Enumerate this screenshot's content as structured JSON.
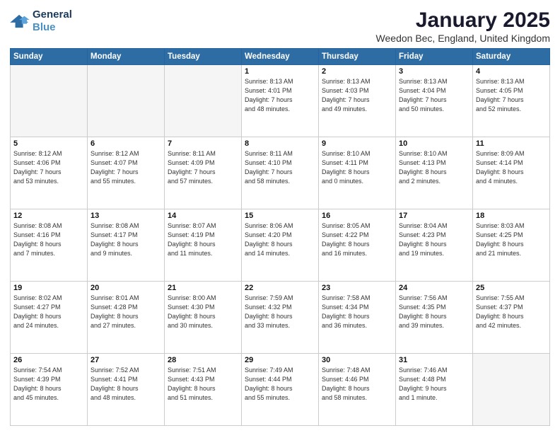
{
  "logo": {
    "line1": "General",
    "line2": "Blue"
  },
  "header": {
    "title": "January 2025",
    "location": "Weedon Bec, England, United Kingdom"
  },
  "weekdays": [
    "Sunday",
    "Monday",
    "Tuesday",
    "Wednesday",
    "Thursday",
    "Friday",
    "Saturday"
  ],
  "weeks": [
    [
      {
        "day": "",
        "text": "",
        "empty": true
      },
      {
        "day": "",
        "text": "",
        "empty": true
      },
      {
        "day": "",
        "text": "",
        "empty": true
      },
      {
        "day": "1",
        "text": "Sunrise: 8:13 AM\nSunset: 4:01 PM\nDaylight: 7 hours\nand 48 minutes."
      },
      {
        "day": "2",
        "text": "Sunrise: 8:13 AM\nSunset: 4:03 PM\nDaylight: 7 hours\nand 49 minutes."
      },
      {
        "day": "3",
        "text": "Sunrise: 8:13 AM\nSunset: 4:04 PM\nDaylight: 7 hours\nand 50 minutes."
      },
      {
        "day": "4",
        "text": "Sunrise: 8:13 AM\nSunset: 4:05 PM\nDaylight: 7 hours\nand 52 minutes."
      }
    ],
    [
      {
        "day": "5",
        "text": "Sunrise: 8:12 AM\nSunset: 4:06 PM\nDaylight: 7 hours\nand 53 minutes."
      },
      {
        "day": "6",
        "text": "Sunrise: 8:12 AM\nSunset: 4:07 PM\nDaylight: 7 hours\nand 55 minutes."
      },
      {
        "day": "7",
        "text": "Sunrise: 8:11 AM\nSunset: 4:09 PM\nDaylight: 7 hours\nand 57 minutes."
      },
      {
        "day": "8",
        "text": "Sunrise: 8:11 AM\nSunset: 4:10 PM\nDaylight: 7 hours\nand 58 minutes."
      },
      {
        "day": "9",
        "text": "Sunrise: 8:10 AM\nSunset: 4:11 PM\nDaylight: 8 hours\nand 0 minutes."
      },
      {
        "day": "10",
        "text": "Sunrise: 8:10 AM\nSunset: 4:13 PM\nDaylight: 8 hours\nand 2 minutes."
      },
      {
        "day": "11",
        "text": "Sunrise: 8:09 AM\nSunset: 4:14 PM\nDaylight: 8 hours\nand 4 minutes."
      }
    ],
    [
      {
        "day": "12",
        "text": "Sunrise: 8:08 AM\nSunset: 4:16 PM\nDaylight: 8 hours\nand 7 minutes."
      },
      {
        "day": "13",
        "text": "Sunrise: 8:08 AM\nSunset: 4:17 PM\nDaylight: 8 hours\nand 9 minutes."
      },
      {
        "day": "14",
        "text": "Sunrise: 8:07 AM\nSunset: 4:19 PM\nDaylight: 8 hours\nand 11 minutes."
      },
      {
        "day": "15",
        "text": "Sunrise: 8:06 AM\nSunset: 4:20 PM\nDaylight: 8 hours\nand 14 minutes."
      },
      {
        "day": "16",
        "text": "Sunrise: 8:05 AM\nSunset: 4:22 PM\nDaylight: 8 hours\nand 16 minutes."
      },
      {
        "day": "17",
        "text": "Sunrise: 8:04 AM\nSunset: 4:23 PM\nDaylight: 8 hours\nand 19 minutes."
      },
      {
        "day": "18",
        "text": "Sunrise: 8:03 AM\nSunset: 4:25 PM\nDaylight: 8 hours\nand 21 minutes."
      }
    ],
    [
      {
        "day": "19",
        "text": "Sunrise: 8:02 AM\nSunset: 4:27 PM\nDaylight: 8 hours\nand 24 minutes."
      },
      {
        "day": "20",
        "text": "Sunrise: 8:01 AM\nSunset: 4:28 PM\nDaylight: 8 hours\nand 27 minutes."
      },
      {
        "day": "21",
        "text": "Sunrise: 8:00 AM\nSunset: 4:30 PM\nDaylight: 8 hours\nand 30 minutes."
      },
      {
        "day": "22",
        "text": "Sunrise: 7:59 AM\nSunset: 4:32 PM\nDaylight: 8 hours\nand 33 minutes."
      },
      {
        "day": "23",
        "text": "Sunrise: 7:58 AM\nSunset: 4:34 PM\nDaylight: 8 hours\nand 36 minutes."
      },
      {
        "day": "24",
        "text": "Sunrise: 7:56 AM\nSunset: 4:35 PM\nDaylight: 8 hours\nand 39 minutes."
      },
      {
        "day": "25",
        "text": "Sunrise: 7:55 AM\nSunset: 4:37 PM\nDaylight: 8 hours\nand 42 minutes."
      }
    ],
    [
      {
        "day": "26",
        "text": "Sunrise: 7:54 AM\nSunset: 4:39 PM\nDaylight: 8 hours\nand 45 minutes."
      },
      {
        "day": "27",
        "text": "Sunrise: 7:52 AM\nSunset: 4:41 PM\nDaylight: 8 hours\nand 48 minutes."
      },
      {
        "day": "28",
        "text": "Sunrise: 7:51 AM\nSunset: 4:43 PM\nDaylight: 8 hours\nand 51 minutes."
      },
      {
        "day": "29",
        "text": "Sunrise: 7:49 AM\nSunset: 4:44 PM\nDaylight: 8 hours\nand 55 minutes."
      },
      {
        "day": "30",
        "text": "Sunrise: 7:48 AM\nSunset: 4:46 PM\nDaylight: 8 hours\nand 58 minutes."
      },
      {
        "day": "31",
        "text": "Sunrise: 7:46 AM\nSunset: 4:48 PM\nDaylight: 9 hours\nand 1 minute."
      },
      {
        "day": "",
        "text": "",
        "empty": true
      }
    ]
  ]
}
